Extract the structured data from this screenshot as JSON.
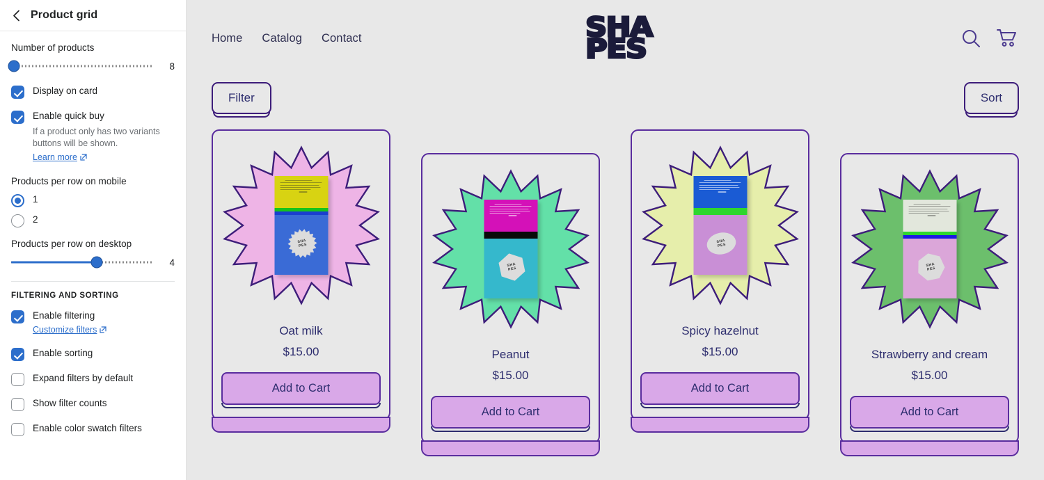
{
  "sidebar": {
    "title": "Product grid",
    "back_icon": "chevron-left-icon",
    "number_of_products": {
      "label": "Number of products",
      "value": "8",
      "fill_percent": 2
    },
    "display_on_card": {
      "label": "Display on card",
      "checked": true
    },
    "enable_quick_buy": {
      "label": "Enable quick buy",
      "checked": true,
      "help": "If a product only has two variants buttons will be shown.",
      "link": "Learn more"
    },
    "products_per_row_mobile": {
      "label": "Products per row on mobile",
      "options": [
        "1",
        "2"
      ],
      "selected": "1"
    },
    "products_per_row_desktop": {
      "label": "Products per row on desktop",
      "value": "4",
      "fill_percent": 60
    },
    "filtering_section": {
      "heading": "FILTERING AND SORTING",
      "items": [
        {
          "label": "Enable filtering",
          "checked": true,
          "link": "Customize filters"
        },
        {
          "label": "Enable sorting",
          "checked": true
        },
        {
          "label": "Expand filters by default",
          "checked": false
        },
        {
          "label": "Show filter counts",
          "checked": false
        },
        {
          "label": "Enable color swatch filters",
          "checked": false
        }
      ]
    }
  },
  "storefront": {
    "nav": [
      "Home",
      "Catalog",
      "Contact"
    ],
    "logo": {
      "line1": "SHA",
      "line2": "PES"
    },
    "actions": [
      {
        "name": "search-icon"
      },
      {
        "name": "cart-icon"
      }
    ],
    "toolbar": {
      "filter_label": "Filter",
      "sort_label": "Sort"
    },
    "products": [
      {
        "title": "Oat milk",
        "price": "$15.00",
        "cta": "Add to Cart",
        "burst": {
          "fill": "#eeb4e6",
          "stroke": "#3d1d7a",
          "points": 18
        },
        "package": {
          "top": "#d8d312",
          "stripe1": "#16c31b",
          "stripe2": "#1a3fd0",
          "body": "#3a6bd6",
          "text_dark": true
        },
        "badge": {
          "shape": "starburst",
          "text": "SHA PES"
        },
        "offset": false
      },
      {
        "title": "Peanut",
        "price": "$15.00",
        "cta": "Add to Cart",
        "burst": {
          "fill": "#63e0a8",
          "stroke": "#3d1d7a",
          "points": 18
        },
        "package": {
          "top": "#d411b8",
          "stripe1": "#0a0a0a",
          "stripe2": "#0a0a0a",
          "body": "#35b8cc",
          "text_dark": false
        },
        "badge": {
          "shape": "hexagon",
          "text": "SHA PES"
        },
        "offset": true
      },
      {
        "title": "Spicy hazelnut",
        "price": "$15.00",
        "cta": "Add to Cart",
        "burst": {
          "fill": "#e6eeab",
          "stroke": "#3d1d7a",
          "points": 18
        },
        "package": {
          "top": "#1a5bd4",
          "stripe1": "#2ed62e",
          "stripe2": "#2ed62e",
          "body": "#c98fd6",
          "text_dark": false
        },
        "badge": {
          "shape": "ellipse",
          "text": "SHA PES"
        },
        "offset": false
      },
      {
        "title": "Strawberry and cream",
        "price": "$15.00",
        "cta": "Add to Cart",
        "burst": {
          "fill": "#6cbf6c",
          "stroke": "#3d1d7a",
          "points": 18
        },
        "package": {
          "top": "#e2e7dc",
          "stripe1": "#2ed62e",
          "stripe2": "#1a1ae0",
          "body": "#dba6d9",
          "text_dark": true
        },
        "badge": {
          "shape": "heptagon",
          "text": "SHA PES"
        },
        "offset": true
      }
    ]
  },
  "colors": {
    "accent_blue": "#2c6ecb",
    "brand_purple": "#5a2d9e",
    "brand_navy": "#2d2d6e",
    "page_bg": "#e8e8e8",
    "button_pink": "#d9a8e8"
  }
}
